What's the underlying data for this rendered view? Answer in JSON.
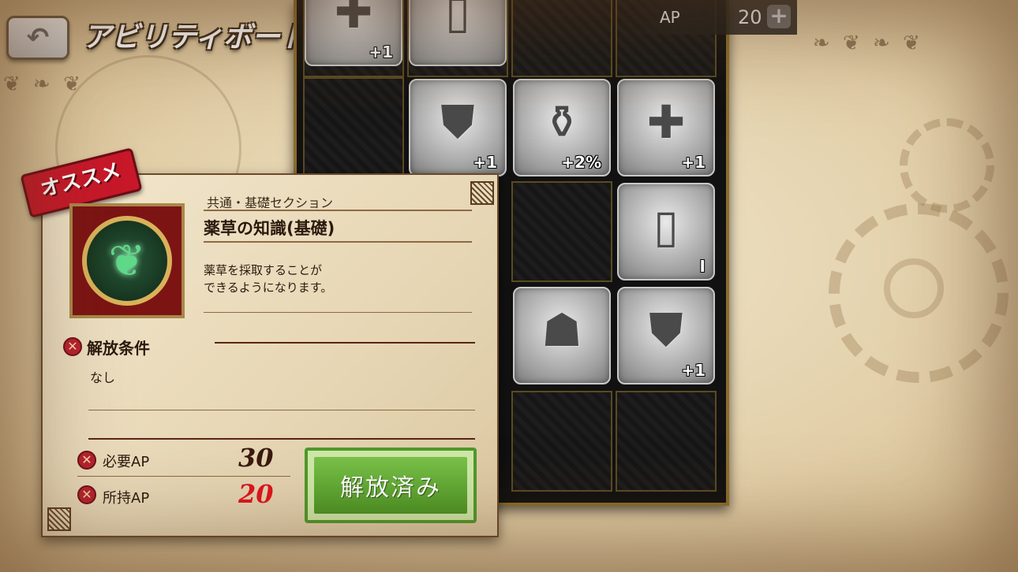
{
  "header": {
    "title": "アビリティボード",
    "back_icon": "back-arrow-icon",
    "ap_label": "AP",
    "ap_value": "20",
    "ap_add_icon": "plus-icon"
  },
  "board": {
    "tiles": [
      {
        "id": "t0",
        "icon": "sword-icon",
        "glyph": "✚",
        "badge": "+1"
      },
      {
        "id": "t1",
        "icon": "scroll-icon",
        "glyph": "▯",
        "badge": ""
      },
      {
        "id": "t2",
        "icon": "shield-icon",
        "glyph": "⛊",
        "badge": "+1"
      },
      {
        "id": "t3",
        "icon": "potion-icon",
        "glyph": "⚱",
        "badge": "+2%"
      },
      {
        "id": "t4",
        "icon": "sword-icon",
        "glyph": "✚",
        "badge": "+1"
      },
      {
        "id": "t5",
        "icon": "scroll-icon",
        "glyph": "▯",
        "badge": "I"
      },
      {
        "id": "t6",
        "icon": "map-scroll-icon",
        "glyph": "☗",
        "badge": ""
      },
      {
        "id": "t7",
        "icon": "shield-icon",
        "glyph": "⛊",
        "badge": "+1"
      }
    ]
  },
  "detail": {
    "recommend_label": "オススメ",
    "skill_icon": "herb-icon",
    "section": "共通・基礎セクション",
    "name": "薬草の知識(基礎)",
    "description": "薬草を採取することが\nできるようになります。",
    "condition_heading": "解放条件",
    "condition_text": "なし",
    "required_ap_label": "必要AP",
    "required_ap_value": "30",
    "owned_ap_label": "所持AP",
    "owned_ap_value": "20",
    "unlock_button": "解放済み"
  },
  "colors": {
    "owned_ap": "#e0141e",
    "required_ap": "#3a1a0e",
    "unlock_green": "#5aa82e",
    "recommend_red": "#c8182a"
  }
}
